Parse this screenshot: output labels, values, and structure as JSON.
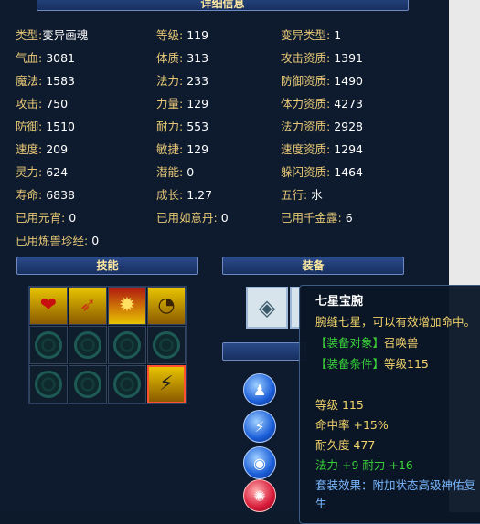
{
  "header": {
    "title": "详细信息"
  },
  "stats": [
    {
      "label": "类型:",
      "value": "变异画魂"
    },
    {
      "label": "等级:",
      "value": "119"
    },
    {
      "label": "变异类型:",
      "value": "1"
    },
    {
      "label": "气血:",
      "value": "3081"
    },
    {
      "label": "体质:",
      "value": "313"
    },
    {
      "label": "攻击资质:",
      "value": "1391"
    },
    {
      "label": "魔法:",
      "value": "1583"
    },
    {
      "label": "法力:",
      "value": "233"
    },
    {
      "label": "防御资质:",
      "value": "1490"
    },
    {
      "label": "攻击:",
      "value": "750"
    },
    {
      "label": "力量:",
      "value": "129"
    },
    {
      "label": "体力资质:",
      "value": "4273"
    },
    {
      "label": "防御:",
      "value": "1510"
    },
    {
      "label": "耐力:",
      "value": "553"
    },
    {
      "label": "法力资质:",
      "value": "2928"
    },
    {
      "label": "速度:",
      "value": "209"
    },
    {
      "label": "敏捷:",
      "value": "129"
    },
    {
      "label": "速度资质:",
      "value": "1294"
    },
    {
      "label": "灵力:",
      "value": "624"
    },
    {
      "label": "潜能:",
      "value": "0"
    },
    {
      "label": "躲闪资质:",
      "value": "1464"
    },
    {
      "label": "寿命:",
      "value": "6838"
    },
    {
      "label": "成长:",
      "value": "1.27"
    },
    {
      "label": "五行:",
      "value": "水"
    },
    {
      "label": "已用元宵:",
      "value": "0"
    },
    {
      "label": "已用如意丹:",
      "value": "0"
    },
    {
      "label": "已用千金露:",
      "value": "6"
    },
    {
      "label": "已用炼兽珍经:",
      "value": "0"
    }
  ],
  "sections": {
    "skills": "技能",
    "equipment": "装备"
  },
  "tooltip": {
    "name": "七星宝腕",
    "desc": "腕缝七星，可以有效增加命中。",
    "target_label": "【装备对象】",
    "target_value": "召唤兽",
    "req_label": "【装备条件】",
    "req_value": "等级115",
    "level": "等级 115",
    "hit": "命中率 +15%",
    "durability": "耐久度 477",
    "bonus": "法力 +9 耐力 +16",
    "set_effect": "套装效果：附加状态高级神佑复",
    "set_effect2": "生"
  },
  "colors": {
    "label": "#e8c876",
    "value": "#ffffff",
    "tooltip_title": "#ffffff",
    "tooltip_green": "#3ad23a",
    "tooltip_gold": "#f2d26a",
    "tooltip_blue": "#7ab8ff"
  }
}
